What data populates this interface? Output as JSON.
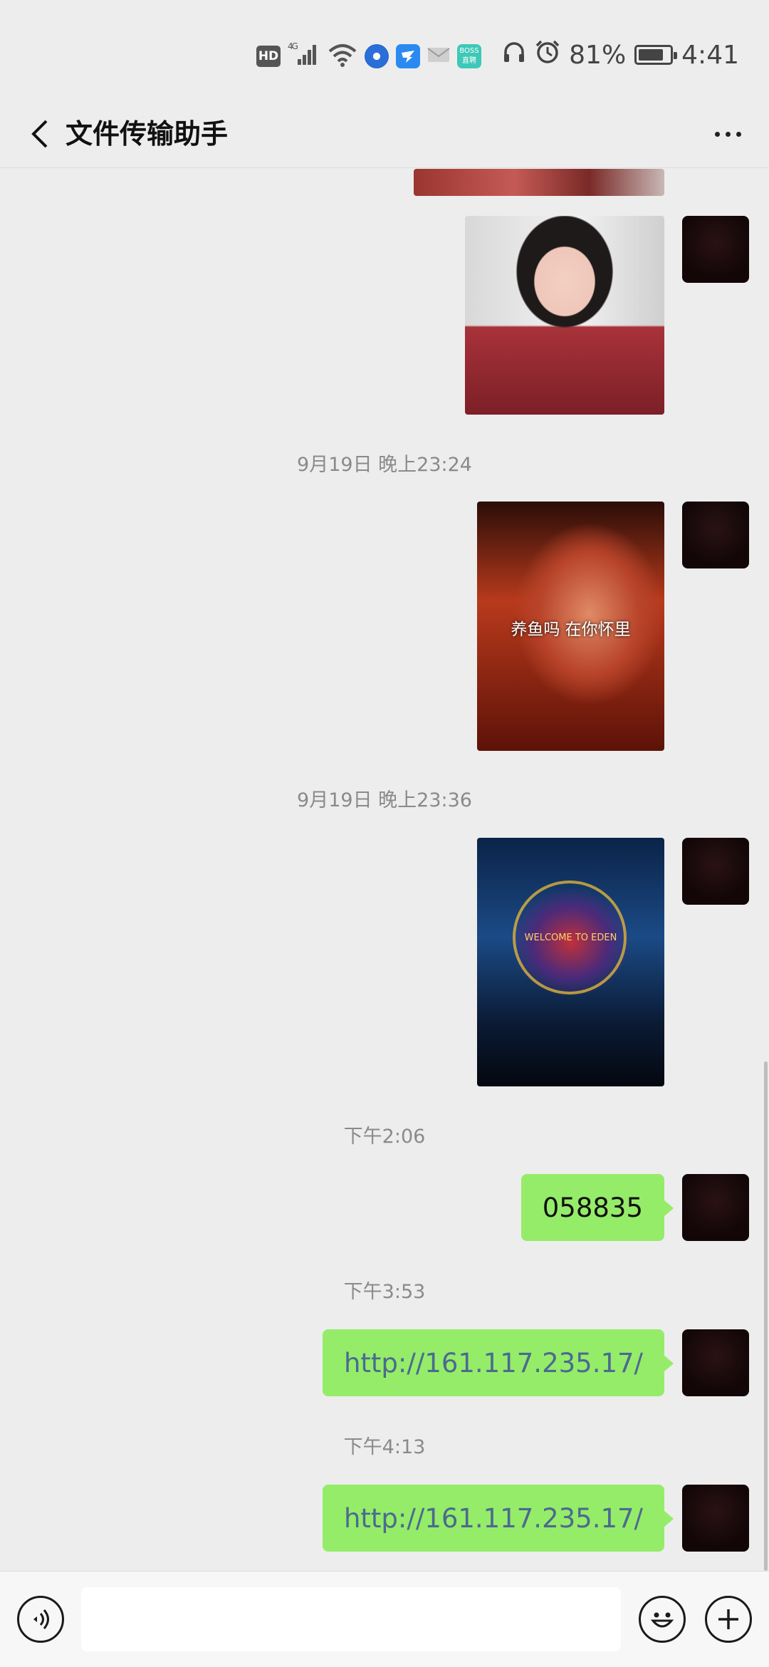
{
  "status_bar": {
    "hd": "HD",
    "network": "4G",
    "boss_app": "BOSS直聘",
    "battery_percent": "81%",
    "battery_level": 0.81,
    "time": "4:41",
    "icons": [
      "hd-icon",
      "signal-icon",
      "wifi-icon",
      "browser-app-icon",
      "dingtalk-app-icon",
      "mail-icon",
      "boss-app-icon",
      "headphones-icon",
      "alarm-icon",
      "battery-icon"
    ]
  },
  "header": {
    "title": "文件传输助手"
  },
  "messages": {
    "ts1": "9月19日 晚上23:24",
    "club_caption": "养鱼吗 在你怀里",
    "ts2": "9月19日 晚上23:36",
    "stage_caption": "WELCOME TO EDEN",
    "ts3": "下午2:06",
    "msg1": "058835",
    "ts4": "下午3:53",
    "msg2": "http://161.117.235.17/",
    "ts5": "下午4:13",
    "msg3": "http://161.117.235.17/"
  },
  "colors": {
    "bubble": "#95ec69",
    "background": "#ededed",
    "link_text": "#4b6a8f"
  }
}
